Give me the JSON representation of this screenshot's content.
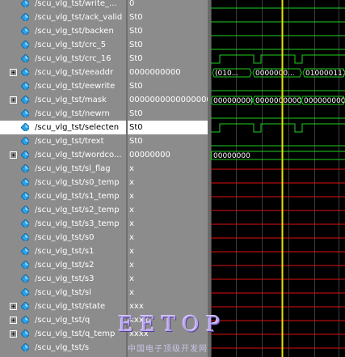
{
  "signals": [
    {
      "name": "/scu_vlg_tst/write_...",
      "value": "0",
      "expandable": false,
      "selected": false,
      "wave": "low-green"
    },
    {
      "name": "/scu_vlg_tst/ack_valid",
      "value": "St0",
      "expandable": false,
      "selected": false,
      "wave": "low-green"
    },
    {
      "name": "/scu_vlg_tst/backen",
      "value": "St0",
      "expandable": false,
      "selected": false,
      "wave": "low-green"
    },
    {
      "name": "/scu_vlg_tst/crc_5",
      "value": "St0",
      "expandable": false,
      "selected": false,
      "wave": "low-green"
    },
    {
      "name": "/scu_vlg_tst/crc_16",
      "value": "St0",
      "expandable": false,
      "selected": false,
      "wave": "pulse"
    },
    {
      "name": "/scu_vlg_tst/eeaddr",
      "value": "0000000000",
      "expandable": true,
      "selected": false,
      "wave": "bus-eeaddr"
    },
    {
      "name": "/scu_vlg_tst/eewrite",
      "value": "St0",
      "expandable": false,
      "selected": false,
      "wave": "low-green"
    },
    {
      "name": "/scu_vlg_tst/mask",
      "value": "0000000000000000",
      "expandable": true,
      "selected": false,
      "wave": "bus-mask"
    },
    {
      "name": "/scu_vlg_tst/newrn",
      "value": "St0",
      "expandable": false,
      "selected": false,
      "wave": "low-green"
    },
    {
      "name": "/scu_vlg_tst/selecten",
      "value": "St0",
      "expandable": false,
      "selected": true,
      "wave": "pulse"
    },
    {
      "name": "/scu_vlg_tst/trext",
      "value": "St0",
      "expandable": false,
      "selected": false,
      "wave": "low-green"
    },
    {
      "name": "/scu_vlg_tst/wordco...",
      "value": "00000000",
      "expandable": true,
      "selected": false,
      "wave": "bus-word"
    },
    {
      "name": "/scu_vlg_tst/sl_flag",
      "value": "x",
      "expandable": false,
      "selected": false,
      "wave": "x-red"
    },
    {
      "name": "/scu_vlg_tst/s0_temp",
      "value": "x",
      "expandable": false,
      "selected": false,
      "wave": "x-red"
    },
    {
      "name": "/scu_vlg_tst/s1_temp",
      "value": "x",
      "expandable": false,
      "selected": false,
      "wave": "x-red"
    },
    {
      "name": "/scu_vlg_tst/s2_temp",
      "value": "x",
      "expandable": false,
      "selected": false,
      "wave": "x-red"
    },
    {
      "name": "/scu_vlg_tst/s3_temp",
      "value": "x",
      "expandable": false,
      "selected": false,
      "wave": "x-red"
    },
    {
      "name": "/scu_vlg_tst/s0",
      "value": "x",
      "expandable": false,
      "selected": false,
      "wave": "x-red"
    },
    {
      "name": "/scu_vlg_tst/s1",
      "value": "x",
      "expandable": false,
      "selected": false,
      "wave": "x-red"
    },
    {
      "name": "/scu_vlg_tst/s2",
      "value": "x",
      "expandable": false,
      "selected": false,
      "wave": "x-red"
    },
    {
      "name": "/scu_vlg_tst/s3",
      "value": "x",
      "expandable": false,
      "selected": false,
      "wave": "x-red"
    },
    {
      "name": "/scu_vlg_tst/sl",
      "value": "x",
      "expandable": false,
      "selected": false,
      "wave": "x-red"
    },
    {
      "name": "/scu_vlg_tst/state",
      "value": "xxx",
      "expandable": true,
      "selected": false,
      "wave": "x-red"
    },
    {
      "name": "/scu_vlg_tst/q",
      "value": "xxxx",
      "expandable": true,
      "selected": false,
      "wave": "x-red"
    },
    {
      "name": "/scu_vlg_tst/q_temp",
      "value": "xxxx",
      "expandable": true,
      "selected": false,
      "wave": "x-red"
    },
    {
      "name": "/scu_vlg_tst/s",
      "value": "",
      "expandable": false,
      "selected": false,
      "wave": "x-red"
    }
  ],
  "wave_labels": {
    "eeaddr": [
      "(010...",
      "0000000...",
      "0100001111"
    ],
    "mask": [
      "0000000000000000",
      "0000000000000",
      "000000000000"
    ],
    "wordco": [
      "00000000"
    ]
  },
  "colors": {
    "pane_bg": "#8c8c8c",
    "wave_green": "#1fd11f",
    "wave_red": "#e01010",
    "cursor": "#e8e000",
    "grid": "#3c3c3c",
    "diamond": "#2aa0e8"
  },
  "icons": {
    "signal": "diamond-icon",
    "expand": "plus-box-icon"
  },
  "watermark": {
    "brand": "EETOP",
    "sub": "中国电子顶级开发网"
  }
}
